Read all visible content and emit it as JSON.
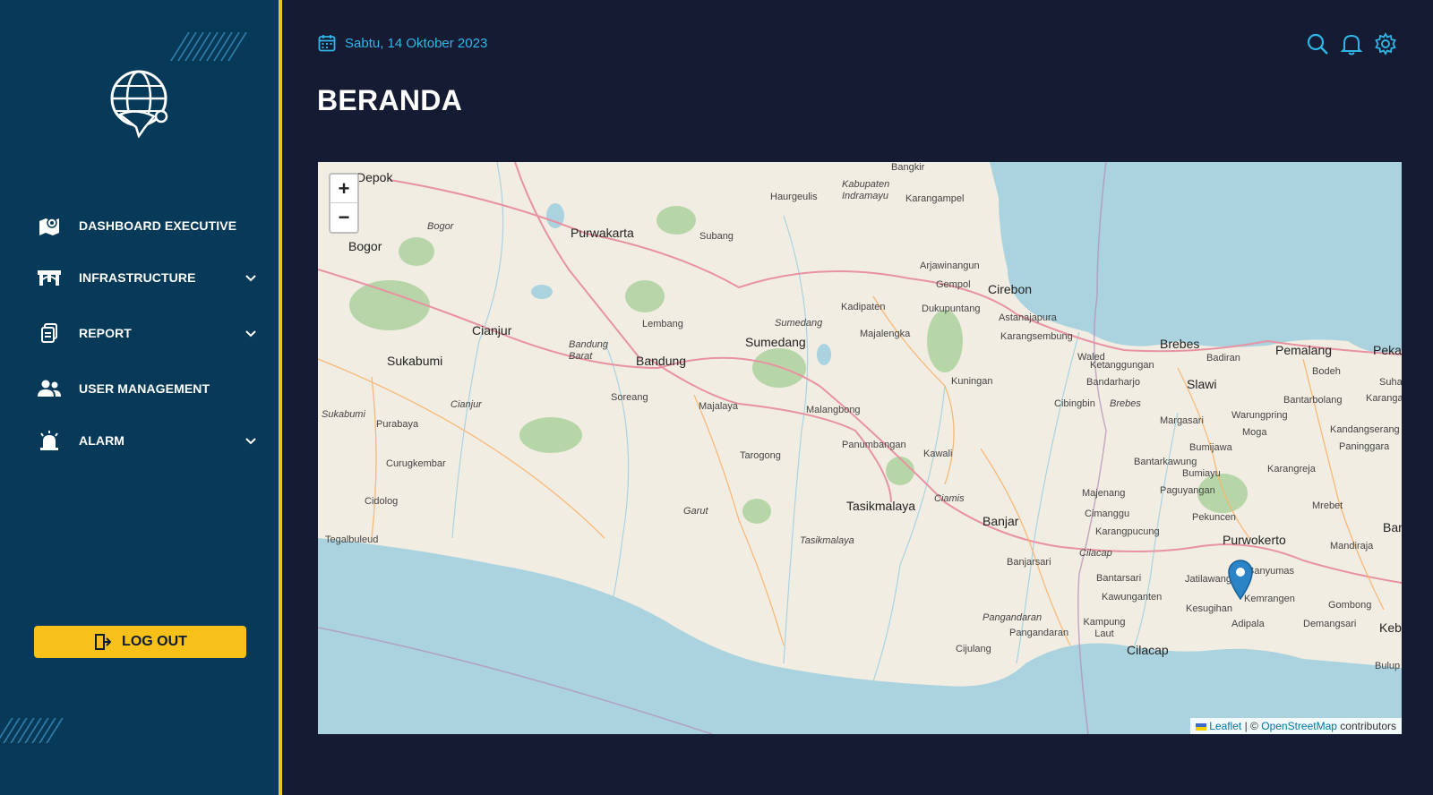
{
  "header": {
    "date": "Sabtu, 14 Oktober 2023",
    "page_title": "BERANDA"
  },
  "sidebar": {
    "items": [
      {
        "label": "DASHBOARD EXECUTIVE",
        "icon": "map-location-icon",
        "expandable": false
      },
      {
        "label": "INFRASTRUCTURE",
        "icon": "bridge-icon",
        "expandable": true
      },
      {
        "label": "REPORT",
        "icon": "report-icon",
        "expandable": true
      },
      {
        "label": "USER MANAGEMENT",
        "icon": "users-icon",
        "expandable": false
      },
      {
        "label": "ALARM",
        "icon": "alarm-icon",
        "expandable": true
      }
    ],
    "logout_label": "LOG OUT"
  },
  "map": {
    "zoom_in": "+",
    "zoom_out": "−",
    "attribution_leaflet": "Leaflet",
    "attribution_sep": "| ©",
    "attribution_osm": "OpenStreetMap",
    "attribution_suffix": "contributors",
    "places": {
      "depok": "Depok",
      "bogor": "Bogor",
      "bogor_region": "Bogor",
      "purwakarta": "Purwakarta",
      "subang": "Subang",
      "haurgeulis": "Haurgeulis",
      "bangkir": "Bangkir",
      "indramayu": "Kabupaten Indramayu",
      "karangampel": "Karangampel",
      "arjawinangun": "Arjawinangun",
      "gempol": "Gempol",
      "cirebon": "Cirebon",
      "kadipaten": "Kadipaten",
      "dukupuntang": "Dukupuntang",
      "astanajapura": "Astanajapura",
      "karangsembung": "Karangsembung",
      "lembang": "Lembang",
      "sumedang_region": "Sumedang",
      "sumedang": "Sumedang",
      "majalengka": "Majalengka",
      "cianjur": "Cianjur",
      "bandung_barat": "Bandung Barat",
      "bandung": "Bandung",
      "sukabumi": "Sukabumi",
      "soreang": "Soreang",
      "majalaya": "Majalaya",
      "malangbong": "Malangbong",
      "kuningan": "Kuningan",
      "waled": "Waled",
      "ketanggungan": "Ketanggungan",
      "bandarharjo": "Bandarharjo",
      "brebes": "Brebes",
      "brebes_region": "Brebes",
      "cibingbin": "Cibingbin",
      "badiran": "Badiran",
      "slawi": "Slawi",
      "pemalang": "Pemalang",
      "bodeh": "Bodeh",
      "pek": "Peka",
      "suha": "Suha",
      "karanga": "Karanga",
      "bantarbolang": "Bantarbolang",
      "warungpring": "Warungpring",
      "margasari": "Margasari",
      "moga": "Moga",
      "kandangserang": "Kandangserang",
      "paninggaran": "Paninggara",
      "sukabumi_region": "Sukabumi",
      "cianjur_region": "Cianjur",
      "purabaya": "Purabaya",
      "curugkembar": "Curugkembar",
      "cidolog": "Cidolog",
      "tegalbuleud": "Tegalbuleud",
      "tarogong": "Tarogong",
      "panumbangan": "Panumbangan",
      "kawali": "Kawali",
      "garut": "Garut",
      "tasikmalaya": "Tasikmalaya",
      "ciamis": "Ciamis",
      "tasikmalaya_region": "Tasikmalaya",
      "banjar": "Banjar",
      "majenang": "Majenang",
      "bumijawa": "Bumijawa",
      "bantarkawung": "Bantarkawung",
      "bumiayu": "Bumiayu",
      "karangreja": "Karangreja",
      "paguyangan": "Paguyangan",
      "mrebet": "Mrebet",
      "cimanggu": "Cimanggu",
      "pekuncen": "Pekuncen",
      "karangpucung": "Karangpucung",
      "purwokerto": "Purwokerto",
      "ban": "Ban",
      "mandiraja": "Mandiraja",
      "cilacap_region": "Cilacap",
      "banjarsari": "Banjarsari",
      "bantarsari": "Bantarsari",
      "jatilawang": "Jatilawang",
      "banyumas": "Banyumas",
      "kawunganten": "Kawunganten",
      "kemrangen": "Kemrangen",
      "gombong": "Gombong",
      "kesugihan": "Kesugihan",
      "pangandaran_region": "Pangandaran",
      "adipala": "Adipala",
      "demangsari": "Demangsari",
      "kebu": "Kebu",
      "pangandaran": "Pangandaran",
      "kampung_laut": "Kampung Laut",
      "cijulang": "Cijulang",
      "cilacap": "Cilacap",
      "bulup": "Bulup"
    }
  }
}
